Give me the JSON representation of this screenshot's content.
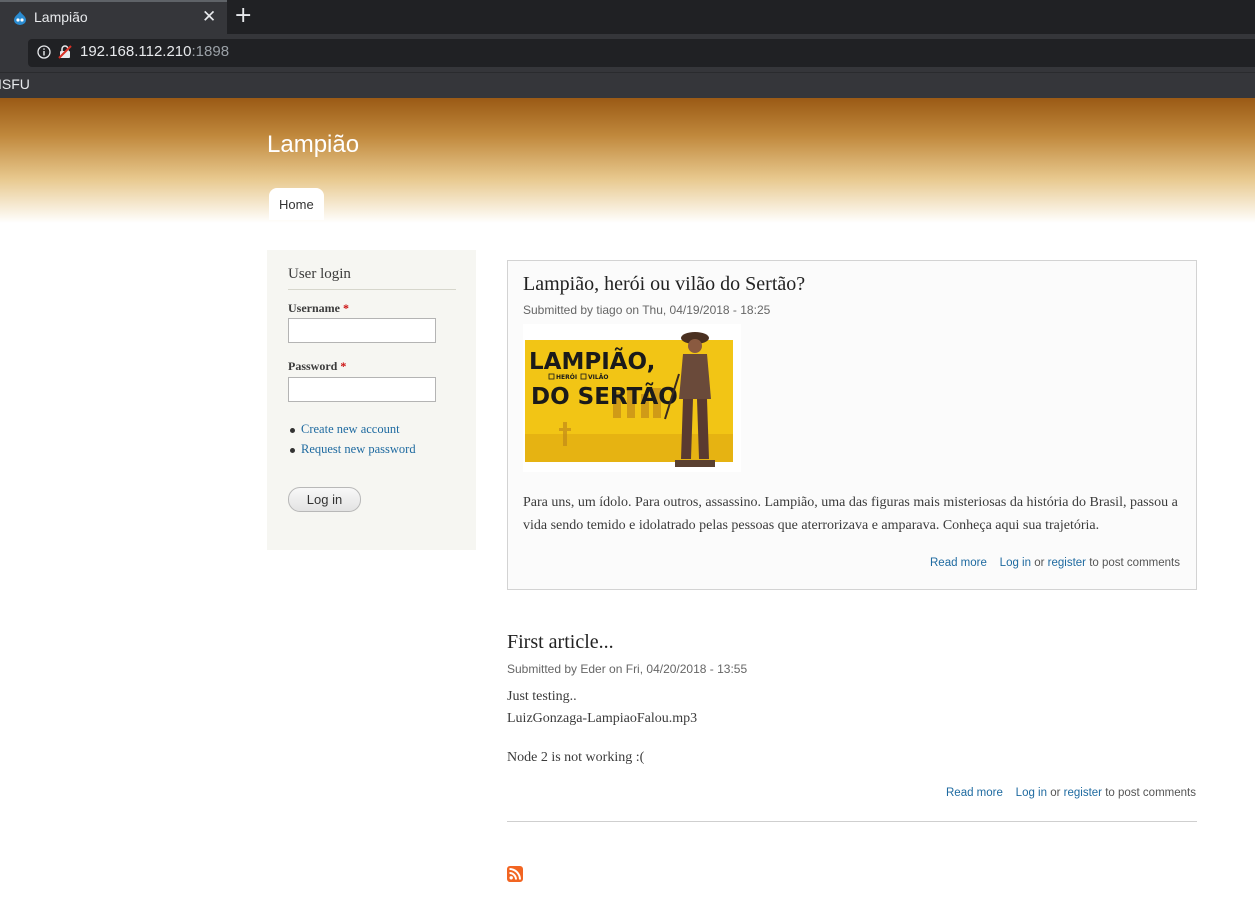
{
  "browser": {
    "tab_title": "Lampião",
    "tab_close_icon": "close-icon",
    "new_tab_icon": "plus-icon",
    "url_host": "192.168.112.210",
    "url_port": ":1898",
    "bookmark": "ISFU"
  },
  "site": {
    "name": "Lampião",
    "nav": [
      {
        "label": "Home"
      }
    ]
  },
  "login": {
    "title": "User login",
    "username_label": "Username",
    "password_label": "Password",
    "required_mark": "*",
    "links": [
      {
        "label": "Create new account"
      },
      {
        "label": "Request new password"
      }
    ],
    "button": "Log in"
  },
  "nodes": [
    {
      "title": "Lampião, herói ou vilão do Sertão?",
      "submitted": "Submitted by tiago on Thu, 04/19/2018 - 18:25",
      "image_text": {
        "line1": "LAMPIÃO,",
        "opt1": "HERÓI",
        "opt2": "VILÃO",
        "line2": "DO SERTÃO"
      },
      "body": "Para uns, um ídolo. Para outros, assassino. Lampião, uma das figuras mais misteriosas da história do Brasil, passou a vida sendo temido e idolatrado pelas pessoas que aterrorizava e amparava. Conheça aqui sua trajetória.",
      "read_more": "Read more",
      "log_in": "Log in",
      "or": "or",
      "register": "register",
      "to_post": "to post comments"
    },
    {
      "title": "First article...",
      "submitted": "Submitted by Eder on Fri, 04/20/2018 - 13:55",
      "lines": [
        "Just testing..",
        "LuizGonzaga-LampiaoFalou.mp3",
        "Node 2 is not working :("
      ],
      "read_more": "Read more",
      "log_in": "Log in",
      "or": "or",
      "register": "register",
      "to_post": "to post comments"
    }
  ],
  "colors": {
    "header_top": "#9a5a15",
    "link": "#1e6aa0",
    "rss": "#f26522"
  },
  "feed_icon": "rss-feed-icon"
}
